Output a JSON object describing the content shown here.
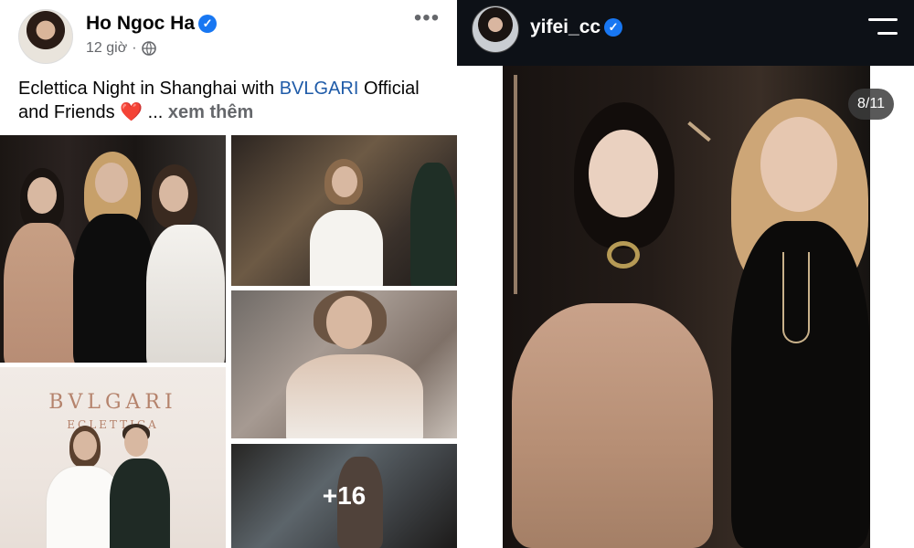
{
  "facebook_post": {
    "author": "Ho Ngoc Ha",
    "time": "12 giờ",
    "separator": "·",
    "more_options": "•••",
    "verified_mark": "✓",
    "caption_prefix": "Eclettica Night in Shanghai with ",
    "caption_tag": "BVLGARI",
    "caption_suffix": " Official and Friends ",
    "caption_emoji": "❤️",
    "ellipsis": "...",
    "see_more": "xem thêm",
    "photo4_brand": "BVLGARI",
    "photo4_subbrand": "ECLETTICA",
    "more_photos": "+16",
    "icons": [
      "globe-icon",
      "more-options-icon",
      "verified-badge-icon"
    ]
  },
  "instagram_story": {
    "username": "yifei_cc",
    "verified_mark": "✓",
    "counter": "8/11",
    "icons": [
      "menu-icon",
      "verified-badge-icon"
    ]
  },
  "colors": {
    "facebook_blue": "#1877f2",
    "tag_blue": "#1f5ba8",
    "meta_gray": "#65676b",
    "instagram_bar": "#0d1117",
    "bvlgari_rose": "#b5836c"
  }
}
